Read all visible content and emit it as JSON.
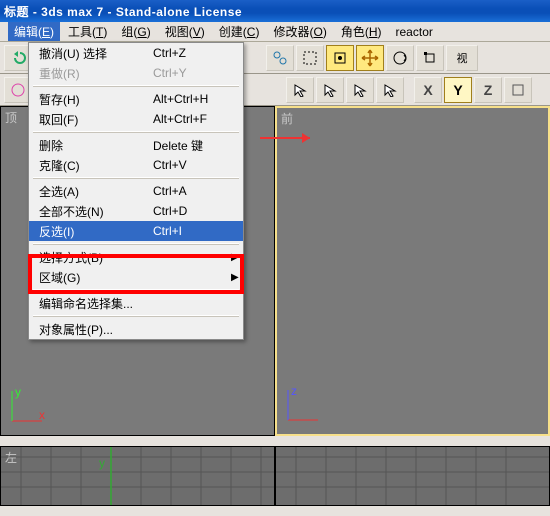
{
  "title": "标题 - 3ds max 7  - Stand-alone License",
  "menubar": {
    "items": [
      {
        "label": "编辑",
        "mn": "E"
      },
      {
        "label": "工具",
        "mn": "T"
      },
      {
        "label": "组",
        "mn": "G"
      },
      {
        "label": "视图",
        "mn": "V"
      },
      {
        "label": "创建",
        "mn": "C"
      },
      {
        "label": "修改器",
        "mn": "O"
      },
      {
        "label": "角色",
        "mn": "H"
      },
      {
        "label": "reactor",
        "mn": ""
      }
    ]
  },
  "dropdown": {
    "items": [
      {
        "label": "撤消(U) 选择",
        "shortcut": "Ctrl+Z",
        "enabled": true
      },
      {
        "label": "重做(R)",
        "shortcut": "Ctrl+Y",
        "enabled": false
      },
      {
        "sep": true
      },
      {
        "label": "暂存(H)",
        "shortcut": "Alt+Ctrl+H",
        "enabled": true
      },
      {
        "label": "取回(F)",
        "shortcut": "Alt+Ctrl+F",
        "enabled": true
      },
      {
        "sep": true
      },
      {
        "label": "删除",
        "shortcut": "Delete 键",
        "enabled": true
      },
      {
        "label": "克隆(C)",
        "shortcut": "Ctrl+V",
        "enabled": true
      },
      {
        "sep": true
      },
      {
        "label": "全选(A)",
        "shortcut": "Ctrl+A",
        "enabled": true
      },
      {
        "label": "全部不选(N)",
        "shortcut": "Ctrl+D",
        "enabled": true
      },
      {
        "label": "反选(I)",
        "shortcut": "Ctrl+I",
        "enabled": true,
        "selected": true
      },
      {
        "sep": true
      },
      {
        "label": "选择方式(B)",
        "shortcut": "",
        "enabled": true,
        "submenu": true
      },
      {
        "label": "区域(G)",
        "shortcut": "",
        "enabled": true,
        "submenu": true
      },
      {
        "sep": true
      },
      {
        "label": "编辑命名选择集...",
        "shortcut": "",
        "enabled": true
      },
      {
        "sep": true
      },
      {
        "label": "对象属性(P)...",
        "shortcut": "",
        "enabled": true
      }
    ]
  },
  "axes": {
    "x": "X",
    "y": "Y",
    "z": "Z"
  },
  "viewports": {
    "tl": "顶",
    "tr": "前",
    "bl": "左",
    "br": ""
  },
  "timeline": {
    "axis_label": "y"
  },
  "gizmo": {
    "x": "x",
    "y": "y",
    "z": "z"
  }
}
